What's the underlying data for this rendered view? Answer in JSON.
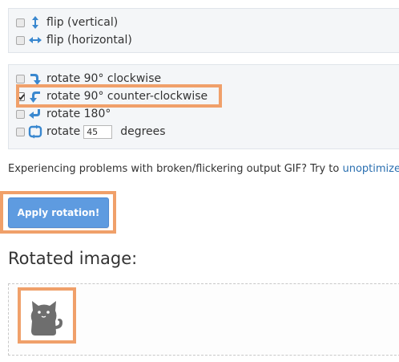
{
  "flip": {
    "vertical": {
      "label": "flip (vertical)",
      "checked": false,
      "icon": "arrows-vertical-icon"
    },
    "horizontal": {
      "label": "flip (horizontal)",
      "checked": false,
      "icon": "arrows-horizontal-icon"
    }
  },
  "rotate": {
    "cw90": {
      "label": "rotate 90° clockwise",
      "checked": false,
      "icon": "rotate-clockwise-icon"
    },
    "ccw90": {
      "label": "rotate 90° counter-clockwise",
      "checked": true,
      "icon": "rotate-counter-clockwise-icon"
    },
    "r180": {
      "label": "rotate 180°",
      "checked": false,
      "icon": "rotate-180-icon"
    },
    "custom": {
      "label": "rotate",
      "value": "45",
      "unit": "degrees",
      "checked": false,
      "icon": "rotate-custom-icon"
    }
  },
  "notice": {
    "text": "Experiencing problems with broken/flickering output GIF? Try to ",
    "link": "unoptimize"
  },
  "apply_button": "Apply rotation!",
  "result": {
    "title": "Rotated image:",
    "image_icon": "cat-icon"
  },
  "colors": {
    "accent": "#5e9be0",
    "highlight": "#f0a06a",
    "icon_blue": "#3a88cf",
    "link": "#2a6fb0"
  }
}
